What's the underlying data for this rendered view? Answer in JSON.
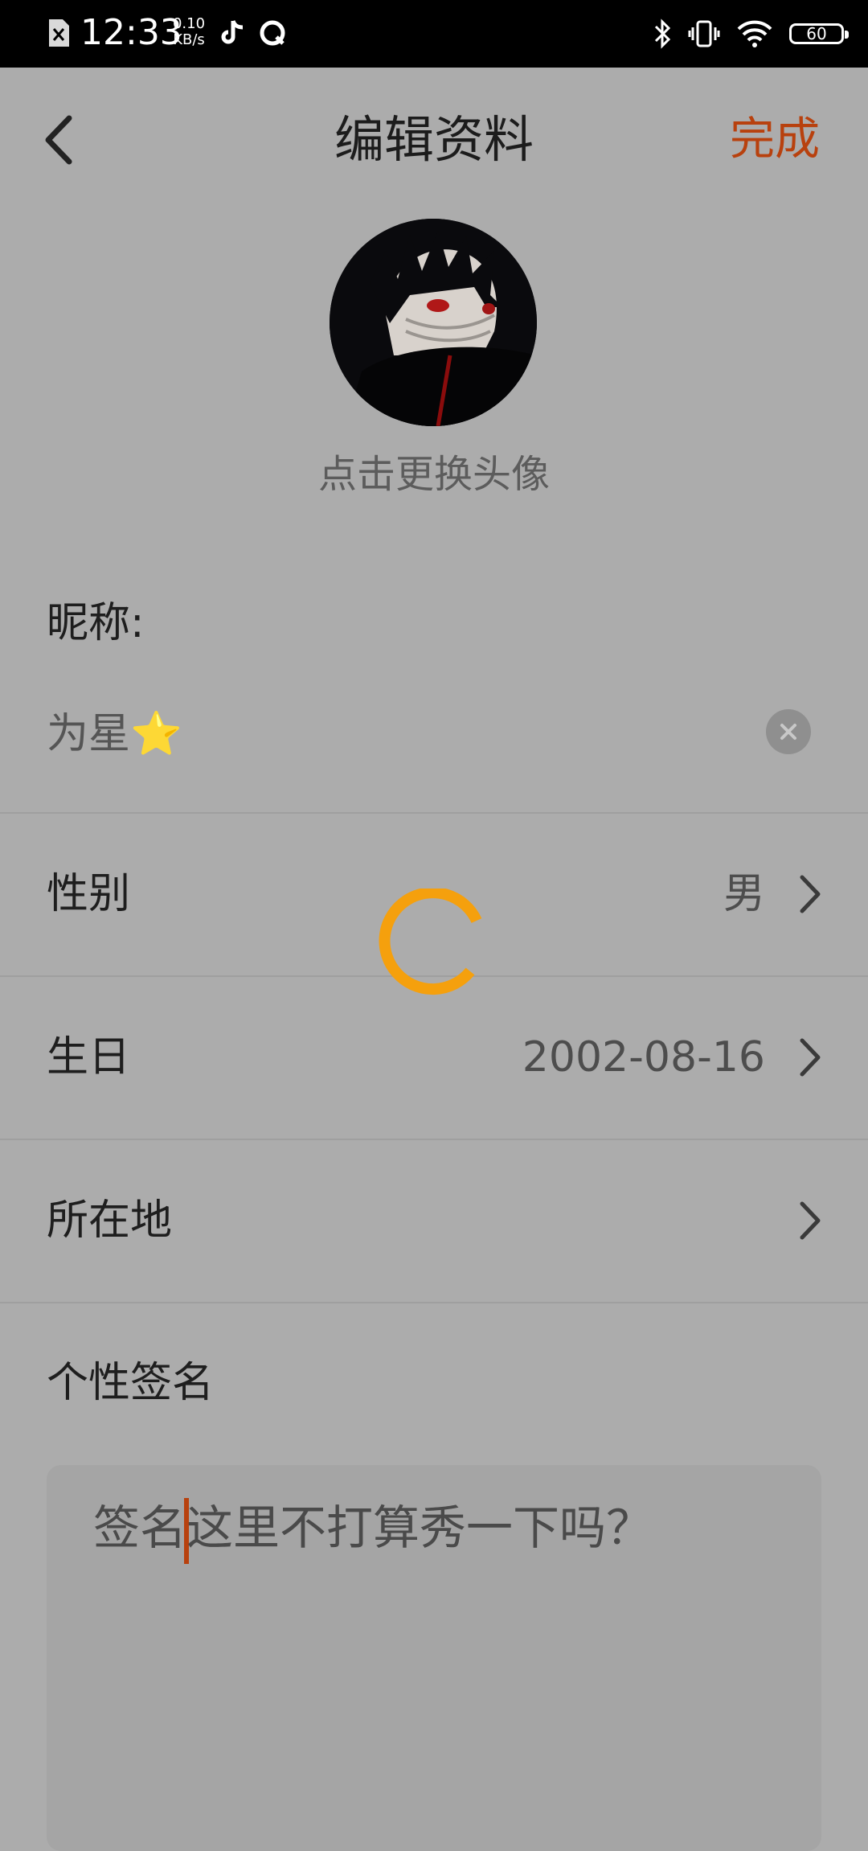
{
  "status_bar": {
    "time": "12:33",
    "net_speed_value": "0.10",
    "net_speed_unit": "KB/s",
    "battery": "60",
    "icons": [
      "sim-none-icon",
      "tiktok-icon",
      "qq-icon",
      "bluetooth-icon",
      "vibrate-icon",
      "wifi-icon",
      "battery-icon"
    ]
  },
  "header": {
    "title": "编辑资料",
    "done_label": "完成"
  },
  "avatar": {
    "hint": "点击更换头像"
  },
  "nickname": {
    "label": "昵称:",
    "value": "为星⭐"
  },
  "rows": [
    {
      "label": "性别",
      "value": "男"
    },
    {
      "label": "生日",
      "value": "2002-08-16"
    },
    {
      "label": "所在地",
      "value": ""
    }
  ],
  "signature": {
    "label": "个性签名",
    "text_before_caret": "签名",
    "text_after_caret": "这里不打算秀一下吗？"
  },
  "colors": {
    "accent": "#b8410e",
    "spinner": "#f5a00d",
    "overlay_bg": "#acacac"
  }
}
